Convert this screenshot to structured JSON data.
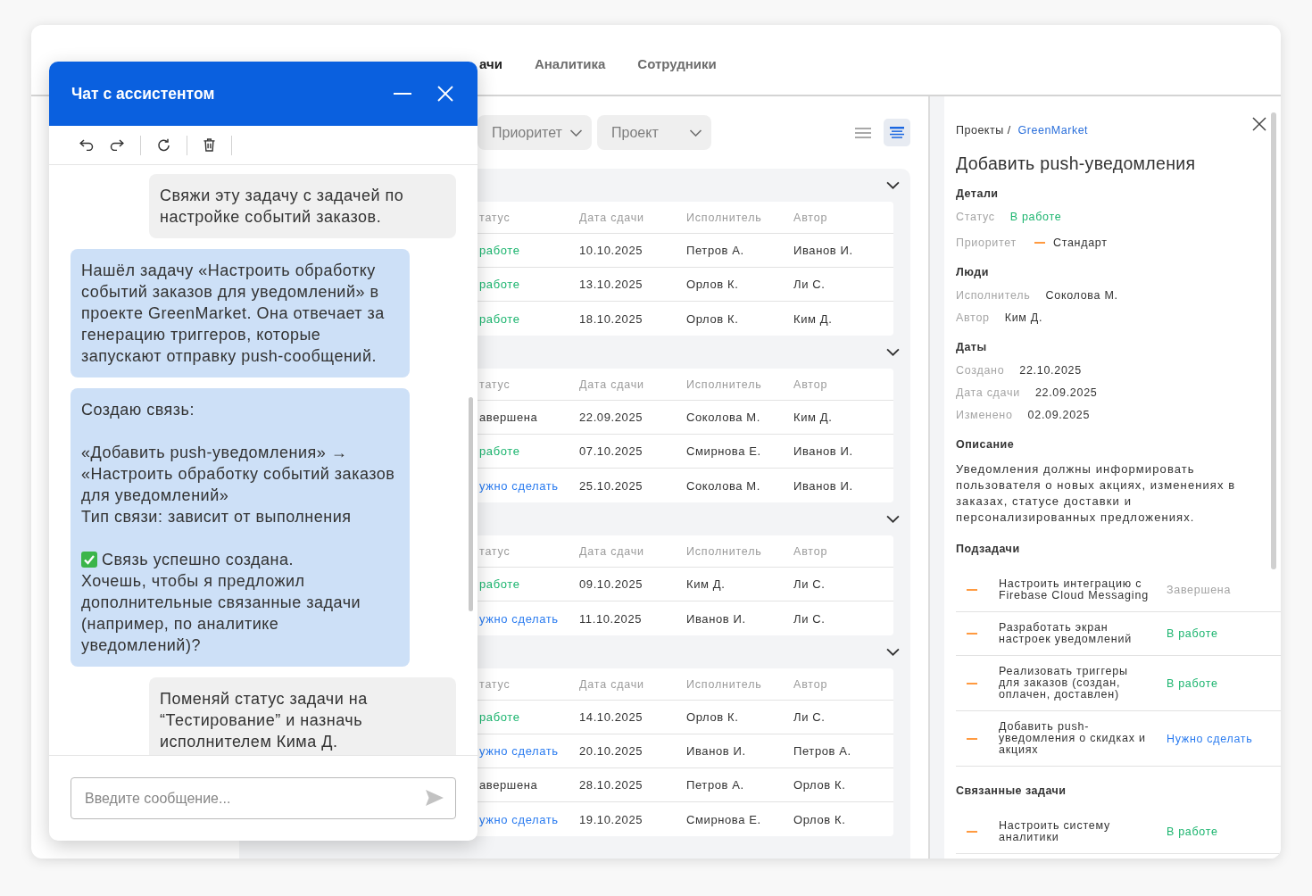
{
  "nav": [
    {
      "label": "ачи",
      "selected": true
    },
    {
      "label": "Аналитика",
      "selected": false
    },
    {
      "label": "Сотрудники",
      "selected": false
    }
  ],
  "filters": [
    {
      "label": "Приоритет"
    },
    {
      "label": "Проект"
    }
  ],
  "views": [
    {
      "kind": "list",
      "selected": false
    },
    {
      "kind": "grouped",
      "selected": true
    }
  ],
  "groups": [
    {
      "expanded": true,
      "columns": [
        "татус",
        "Дата сдачи",
        "Исполнитель",
        "Автор"
      ],
      "rows": [
        {
          "status": {
            "text": "работе",
            "color": "#1cb56f"
          },
          "due": "10.10.2025",
          "assignee": "Петров А.",
          "author": "Иванов И."
        },
        {
          "status": {
            "text": "работе",
            "color": "#1cb56f"
          },
          "due": "13.10.2025",
          "assignee": "Орлов К.",
          "author": "Ли С."
        },
        {
          "status": {
            "text": "работе",
            "color": "#1cb56f"
          },
          "due": "18.10.2025",
          "assignee": "Орлов К.",
          "author": "Ким Д."
        }
      ]
    },
    {
      "expanded": true,
      "columns": [
        "татус",
        "Дата сдачи",
        "Исполнитель",
        "Автор"
      ],
      "rows": [
        {
          "status": {
            "text": "авершена",
            "color": "#333333"
          },
          "due": "22.09.2025",
          "assignee": "Соколова М.",
          "author": "Ким Д."
        },
        {
          "status": {
            "text": "работе",
            "color": "#1cb56f"
          },
          "due": "07.10.2025",
          "assignee": "Смирнова Е.",
          "author": "Иванов И."
        },
        {
          "status": {
            "text": "ужно сделать",
            "color": "#2b7cf0"
          },
          "due": "25.10.2025",
          "assignee": "Соколова М.",
          "author": "Иванов И."
        }
      ]
    },
    {
      "expanded": true,
      "columns": [
        "татус",
        "Дата сдачи",
        "Исполнитель",
        "Автор"
      ],
      "rows": [
        {
          "status": {
            "text": "работе",
            "color": "#1cb56f"
          },
          "due": "09.10.2025",
          "assignee": "Ким Д.",
          "author": "Ли С."
        },
        {
          "status": {
            "text": "ужно сделать",
            "color": "#2b7cf0"
          },
          "due": "11.10.2025",
          "assignee": "Иванов И.",
          "author": "Ли С."
        }
      ]
    },
    {
      "expanded": true,
      "columns": [
        "татус",
        "Дата сдачи",
        "Исполнитель",
        "Автор"
      ],
      "rows": [
        {
          "status": {
            "text": "работе",
            "color": "#1cb56f"
          },
          "due": "14.10.2025",
          "assignee": "Орлов К.",
          "author": "Ли С."
        },
        {
          "status": {
            "text": "ужно сделать",
            "color": "#2b7cf0"
          },
          "due": "20.10.2025",
          "assignee": "Иванов И.",
          "author": "Петров А."
        },
        {
          "status": {
            "text": "авершена",
            "color": "#333333"
          },
          "due": "28.10.2025",
          "assignee": "Петров А.",
          "author": "Орлов К."
        },
        {
          "status": {
            "text": "ужно сделать",
            "color": "#2b7cf0"
          },
          "due": "19.10.2025",
          "assignee": "Смирнова Е.",
          "author": "Орлов К."
        }
      ]
    }
  ],
  "detail": {
    "breadcrumb": [
      {
        "kind": "text",
        "text": "Проекты /"
      },
      {
        "kind": "link",
        "text": "GreenMarket"
      }
    ],
    "title": "Добавить push-уведомления",
    "sections": [
      {
        "kind": "fields",
        "heading": "Детали",
        "fields": [
          {
            "kind": "status",
            "label": "Статус",
            "value": "В работе",
            "color": "#1cb56f"
          },
          {
            "kind": "priority",
            "label": "Приоритет",
            "value": "Стандарт",
            "color": "#ff9a40"
          }
        ]
      },
      {
        "kind": "fields",
        "heading": "Люди",
        "fields": [
          {
            "kind": "text",
            "label": "Исполнитель",
            "value": "Соколова М."
          },
          {
            "kind": "text",
            "label": "Автор",
            "value": "Ким Д."
          }
        ]
      },
      {
        "kind": "fields",
        "heading": "Даты",
        "fields": [
          {
            "kind": "text",
            "label": "Создано",
            "value": "22.10.2025"
          },
          {
            "kind": "text",
            "label": "Дата сдачи",
            "value": "22.09.2025"
          },
          {
            "kind": "text",
            "label": "Изменено",
            "value": "02.09.2025"
          }
        ]
      },
      {
        "kind": "text",
        "heading": "Описание",
        "text": "Уведомления должны информировать пользователя о новых акциях, изменениях в заказах, статусе доставки и персонализированных предложениях."
      },
      {
        "kind": "tasks",
        "heading": "Подзадачи",
        "tasks": [
          {
            "title": "Настроить интеграцию с Firebase Cloud Messaging",
            "color": "#ff9a40",
            "status": {
              "text": "Завершена",
              "color": "#a3a3a3"
            }
          },
          {
            "title": "Разработать экран настроек уведомлений",
            "color": "#ff9a40",
            "status": {
              "text": "В работе",
              "color": "#1cb56f"
            }
          },
          {
            "title": "Реализовать триггеры для заказов (создан, оплачен, доставлен)",
            "color": "#ff9a40",
            "status": {
              "text": "В работе",
              "color": "#1cb56f"
            }
          },
          {
            "title": "Добавить push-уведомления о скидках и акциях",
            "color": "#ff9a40",
            "status": {
              "text": "Нужно сделать",
              "color": "#2b7cf0"
            }
          }
        ]
      },
      {
        "kind": "tasks",
        "heading": "Связанные задачи",
        "tasks": [
          {
            "title": "Настроить систему аналитики",
            "color": "#ff9a40",
            "status": {
              "text": "В работе",
              "color": "#1cb56f"
            }
          }
        ]
      }
    ]
  },
  "chat": {
    "title": "Чат с ассистентом",
    "messages": [
      {
        "kind": "user",
        "paragraphs": [
          {
            "lines": [
              {
                "kind": "text",
                "text": "Свяжи эту задачу с задачей по настройке событий заказов."
              }
            ]
          }
        ]
      },
      {
        "kind": "assistant",
        "paragraphs": [
          {
            "lines": [
              {
                "kind": "text",
                "text": "Нашёл задачу «Настроить обработку событий заказов для уведомлений» в проекте GreenMarket. Она отвечает за генерацию триггеров, которые запускают отправку push-сообщений."
              }
            ]
          }
        ]
      },
      {
        "kind": "assistant",
        "paragraphs": [
          {
            "lines": [
              {
                "kind": "text",
                "text": "Создаю связь:"
              }
            ]
          },
          {
            "lines": [
              {
                "kind": "text",
                "text": "«Добавить push-уведомления» → «Настроить обработку событий заказов для уведомлений»"
              },
              {
                "kind": "text",
                "text": "Тип связи: зависит от выполнения"
              }
            ]
          },
          {
            "lines": [
              {
                "kind": "success",
                "text": "Связь успешно создана."
              },
              {
                "kind": "text",
                "text": "Хочешь, чтобы я предложил дополнительные связанные задачи (например, по аналитике уведомлений)?"
              }
            ]
          }
        ]
      },
      {
        "kind": "user",
        "paragraphs": [
          {
            "lines": [
              {
                "kind": "text",
                "text": "Поменяй статус задачи на “Тестирование” и назначь исполнителем Кима Д."
              }
            ]
          }
        ]
      }
    ],
    "input": {
      "placeholder": "Введите сообщение..."
    }
  }
}
